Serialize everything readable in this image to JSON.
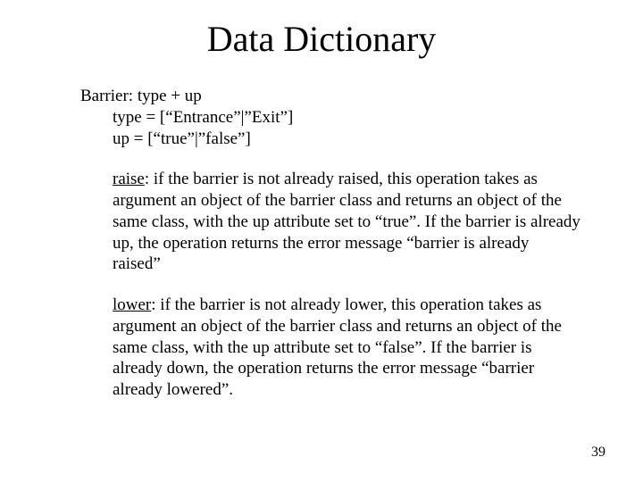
{
  "title": "Data Dictionary",
  "barrier_line": "Barrier: type + up",
  "type_line": "type = [“Entrance”|”Exit”]",
  "up_line": "up = [“true”|”false”]",
  "raise_label": "raise",
  "raise_text": ": if the barrier is not already raised, this operation takes as argument an object of the barrier class and returns an object of the same class, with the up attribute set to “true”. If the barrier is already up, the operation returns the error message “barrier is already raised”",
  "lower_label": "lower",
  "lower_text": ": if the barrier is not already lower, this operation takes as argument an object of the barrier class and returns an object of the same class, with the up attribute set to “false”. If the barrier is already down, the operation returns the error message “barrier already lowered”.",
  "page_number": "39"
}
